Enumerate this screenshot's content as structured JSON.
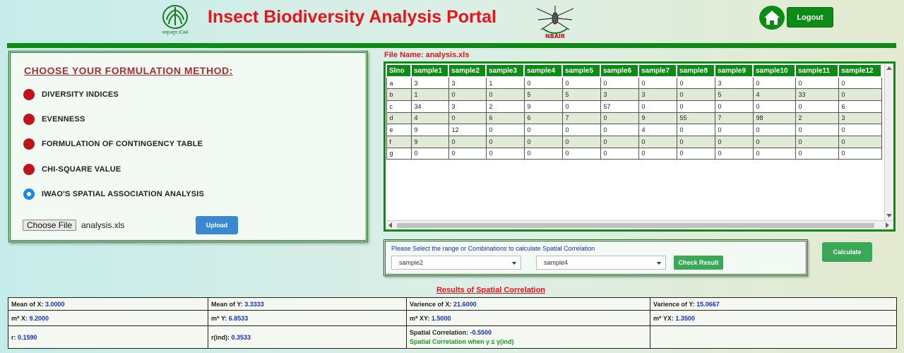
{
  "header": {
    "title": "Insect Biodiversity Analysis Portal",
    "logout_label": "Logout",
    "icar_logo_text": "भाकृअनुप ICAR",
    "nbair_logo_text": "NBAIR"
  },
  "method_panel": {
    "heading": "CHOOSE YOUR FORMULATION METHOD:",
    "options": [
      {
        "label": "DIVERSITY INDICES",
        "selected": false
      },
      {
        "label": "EVENNESS",
        "selected": false
      },
      {
        "label": "FORMULATION OF CONTINGENCY TABLE",
        "selected": false
      },
      {
        "label": "CHI-SQUARE VALUE",
        "selected": false
      },
      {
        "label": "IWAO'S SPATIAL ASSOCIATION ANALYSIS",
        "selected": true
      }
    ],
    "choose_file_label": "Choose File",
    "chosen_file": "analysis.xls",
    "upload_label": "Upload"
  },
  "file_panel": {
    "title": "File Name: analysis.xls",
    "columns": [
      "Slno",
      "sample1",
      "sample2",
      "sample3",
      "sample4",
      "sample5",
      "sample6",
      "sample7",
      "sample8",
      "sample9",
      "sample10",
      "sample11",
      "sample12"
    ],
    "rows": [
      [
        "a",
        "3",
        "3",
        "1",
        "0",
        "0",
        "0",
        "0",
        "0",
        "3",
        "0",
        "0",
        "0"
      ],
      [
        "b",
        "1",
        "0",
        "0",
        "5",
        "5",
        "3",
        "3",
        "0",
        "5",
        "4",
        "33",
        "0"
      ],
      [
        "c",
        "34",
        "3",
        "2",
        "9",
        "0",
        "57",
        "0",
        "0",
        "0",
        "0",
        "0",
        "6"
      ],
      [
        "d",
        "4",
        "0",
        "6",
        "6",
        "7",
        "0",
        "9",
        "55",
        "7",
        "98",
        "2",
        "3"
      ],
      [
        "e",
        "9",
        "12",
        "0",
        "0",
        "0",
        "0",
        "4",
        "0",
        "0",
        "0",
        "0",
        "0"
      ],
      [
        "f",
        "9",
        "0",
        "0",
        "0",
        "0",
        "0",
        "0",
        "0",
        "0",
        "0",
        "0",
        "0"
      ],
      [
        "g",
        "0",
        "0",
        "0",
        "0",
        "0",
        "0",
        "0",
        "0",
        "0",
        "0",
        "0",
        "0"
      ]
    ]
  },
  "selection": {
    "prompt": "Please Select the range or Combinations to calculate Spatial Correlation",
    "select_x": "sample2",
    "select_y": "sample4",
    "check_label": "Check Result",
    "calculate_label": "Calculate"
  },
  "results": {
    "title": "Results of Spatial Correlation",
    "mean_x_label": "Mean of X:",
    "mean_x": "3.0000",
    "mean_y_label": "Mean of Y:",
    "mean_y": "3.3333",
    "var_x_label": "Varience of X:",
    "var_x": "21.6000",
    "var_y_label": "Varience of Y:",
    "var_y": "15.0667",
    "mx_label": "m* X:",
    "mx": "9.2000",
    "my_label": "m* Y:",
    "my": "6.8533",
    "mxy_label": "m* XY:",
    "mxy": "1.5000",
    "myx_label": "m* YX:",
    "myx": "1.3500",
    "r_label": "r:",
    "r": "0.1590",
    "rind_label": "r(ind):",
    "rind": "0.3533",
    "sc_label": "Spatial Correlation:",
    "sc": "-0.5500",
    "sc_note": "Spatial Correlation when γ ≤ γ(ind)"
  }
}
